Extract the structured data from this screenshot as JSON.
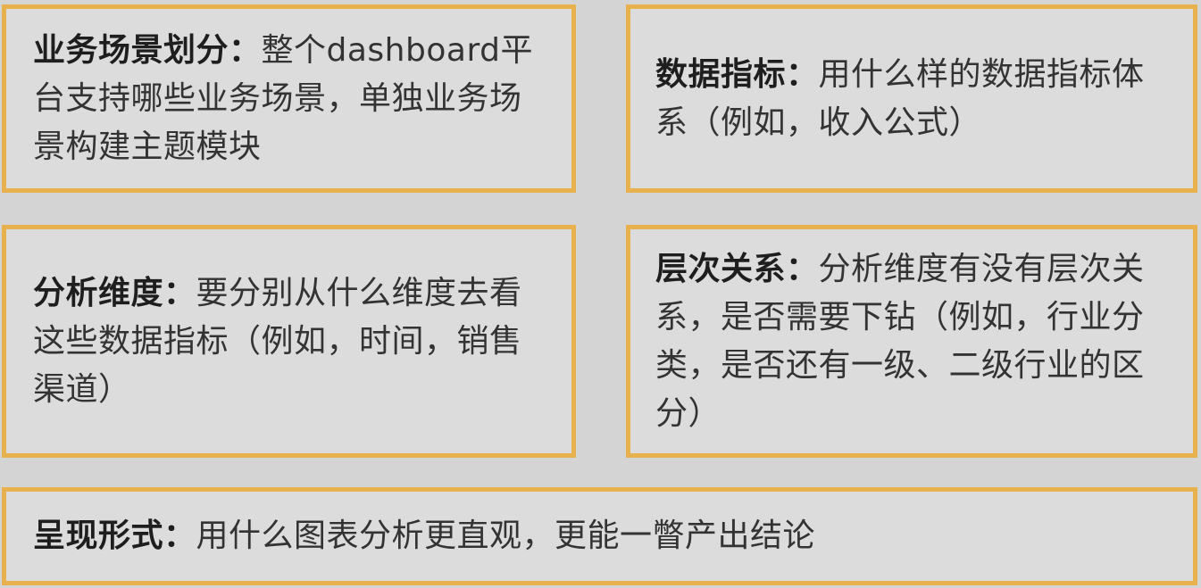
{
  "cards": {
    "scenario": {
      "title": "业务场景划分：",
      "body": "整个dashboard平台支持哪些业务场景，单独业务场景构建主题模块"
    },
    "metrics": {
      "title": "数据指标：",
      "body": "用什么样的数据指标体系（例如，收入公式）"
    },
    "dimension": {
      "title": "分析维度：",
      "body": "要分别从什么维度去看这些数据指标（例如，时间，销售渠道）"
    },
    "hierarchy": {
      "title": "层次关系：",
      "body": "分析维度有没有层次关系，是否需要下钻（例如，行业分类，是否还有一级、二级行业的区分）"
    },
    "presentation": {
      "title": "呈现形式：",
      "body": "用什么图表分析更直观，更能一瞥产出结论"
    }
  },
  "colors": {
    "border": "#e7b24d",
    "card_background": "#dcdcdc",
    "page_background": "#d4d4d4"
  }
}
